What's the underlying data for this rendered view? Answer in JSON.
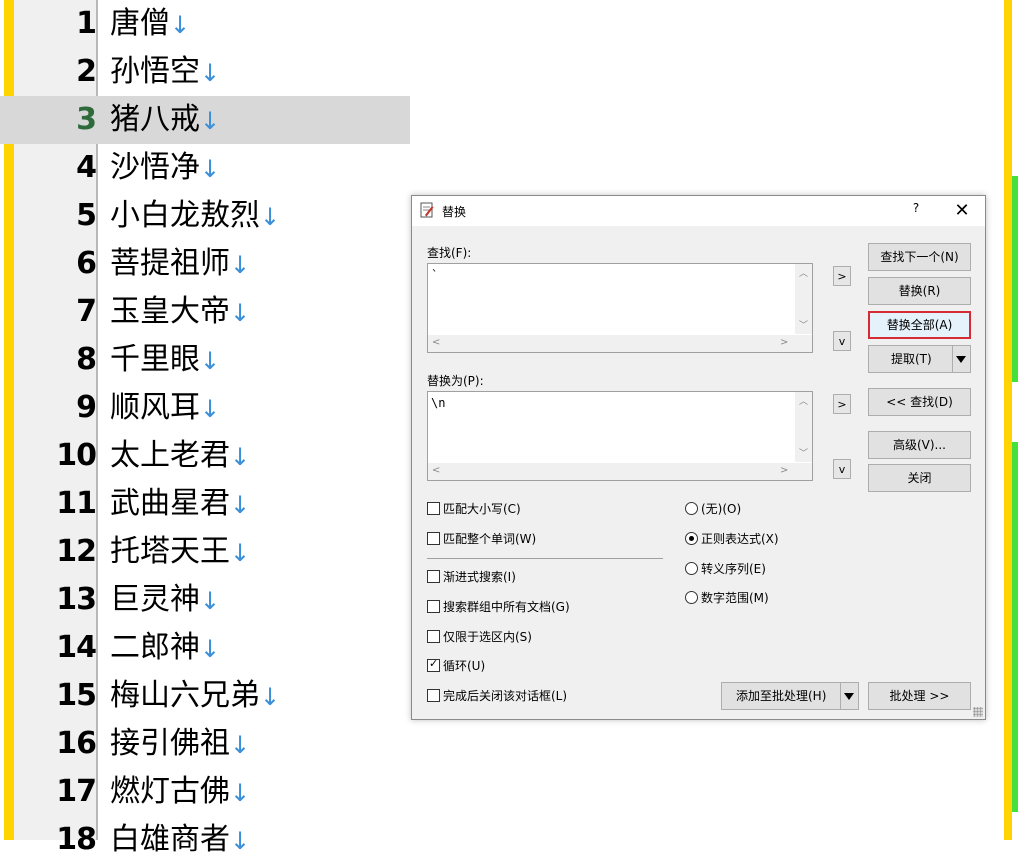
{
  "editor": {
    "current_line": 3,
    "lines": [
      {
        "num": "1",
        "text": "唐僧",
        "eol": "↓"
      },
      {
        "num": "2",
        "text": "孙悟空",
        "eol": "↓"
      },
      {
        "num": "3",
        "text": "猪八戒",
        "eol": "↓"
      },
      {
        "num": "4",
        "text": "沙悟净",
        "eol": "↓"
      },
      {
        "num": "5",
        "text": "小白龙敖烈",
        "eol": "↓"
      },
      {
        "num": "6",
        "text": "菩提祖师",
        "eol": "↓"
      },
      {
        "num": "7",
        "text": "玉皇大帝",
        "eol": "↓"
      },
      {
        "num": "8",
        "text": "千里眼",
        "eol": "↓"
      },
      {
        "num": "9",
        "text": "顺风耳",
        "eol": "↓"
      },
      {
        "num": "10",
        "text": "太上老君",
        "eol": "↓"
      },
      {
        "num": "11",
        "text": "武曲星君",
        "eol": "↓"
      },
      {
        "num": "12",
        "text": "托塔天王",
        "eol": "↓"
      },
      {
        "num": "13",
        "text": "巨灵神",
        "eol": "↓"
      },
      {
        "num": "14",
        "text": "二郎神",
        "eol": "↓"
      },
      {
        "num": "15",
        "text": "梅山六兄弟",
        "eol": "↓"
      },
      {
        "num": "16",
        "text": "接引佛祖",
        "eol": "↓"
      },
      {
        "num": "17",
        "text": "燃灯古佛",
        "eol": "↓"
      },
      {
        "num": "18",
        "text": "白雄商者",
        "eol": "↓"
      }
    ]
  },
  "dialog": {
    "title": "替换",
    "help": "?",
    "close": "✕",
    "find_label": "查找(F):",
    "find_value": "`",
    "replace_label": "替换为(P):",
    "replace_value": "\\n",
    "expand_symbol": ">",
    "history_symbol": "v",
    "buttons": {
      "find_next": "查找下一个(N)",
      "replace": "替换(R)",
      "replace_all": "替换全部(A)",
      "extract": "提取(T)",
      "find": "<< 查找(D)",
      "advanced": "高级(V)...",
      "close": "关闭",
      "add_batch": "添加至批处理(H)",
      "batch": "批处理 >>"
    },
    "options": {
      "match_case": {
        "label": "匹配大小写(C)",
        "checked": false
      },
      "whole_word": {
        "label": "匹配整个单词(W)",
        "checked": false
      },
      "incremental": {
        "label": "渐进式搜索(I)",
        "checked": false
      },
      "all_docs": {
        "label": "搜索群组中所有文档(G)",
        "checked": false
      },
      "selection_only": {
        "label": "仅限于选区内(S)",
        "checked": false
      },
      "wrap": {
        "label": "循环(U)",
        "checked": true
      },
      "close_after": {
        "label": "完成后关闭该对话框(L)",
        "checked": false
      }
    },
    "modes": {
      "none": "(无)(O)",
      "regex": "正则表达式(X)",
      "escape": "转义序列(E)",
      "numeric": "数字范围(M)",
      "selected": "regex"
    }
  },
  "colors": {
    "change_bar": "#ffd400",
    "saved_bar": "#46e03a",
    "eol_marker": "#3b8fd9",
    "focus_border": "#d52b35"
  }
}
